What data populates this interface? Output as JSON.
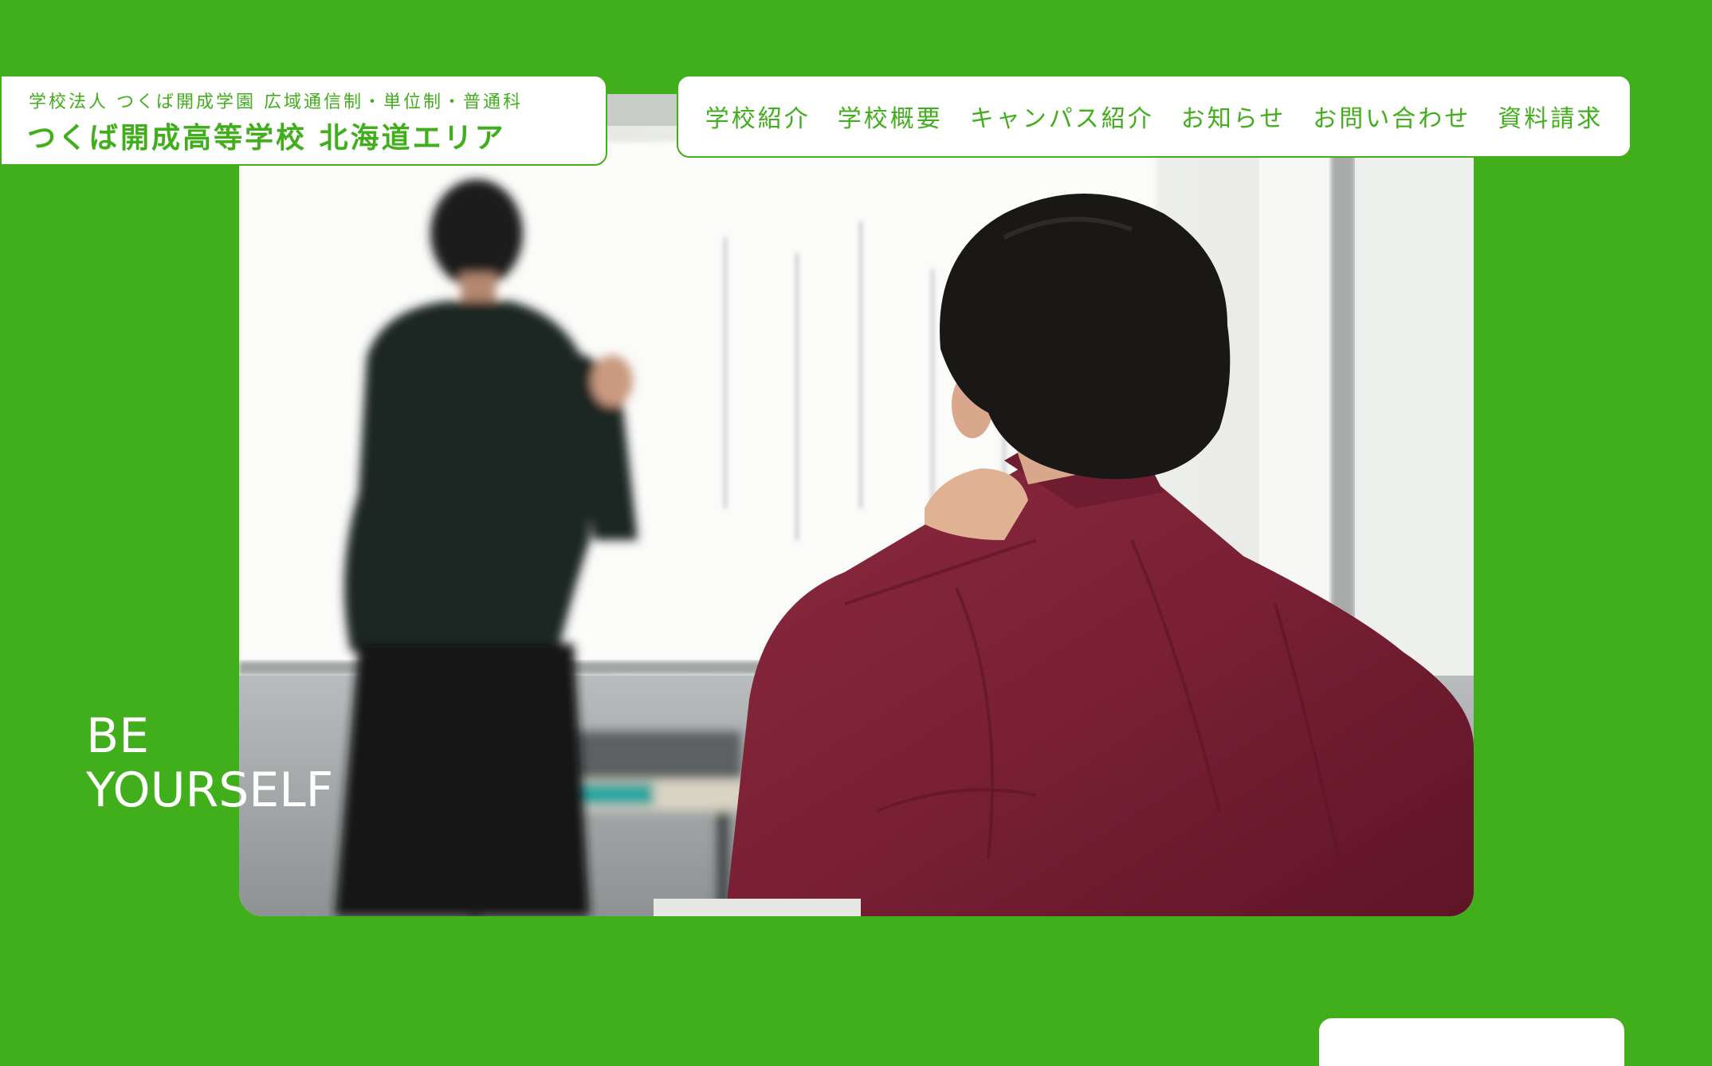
{
  "logo": {
    "subtitle": "学校法人 つくば開成学園 広域通信制・単位制・普通科",
    "title": "つくば開成高等学校 北海道エリア"
  },
  "nav": {
    "items": [
      {
        "label": "学校紹介"
      },
      {
        "label": "学校概要"
      },
      {
        "label": "キャンパス紹介"
      },
      {
        "label": "お知らせ"
      },
      {
        "label": "お問い合わせ"
      },
      {
        "label": "資料請求"
      }
    ]
  },
  "hero": {
    "tagline_line1": "BE",
    "tagline_line2": "YOURSELF"
  },
  "colors": {
    "brand_green": "#41ae1b",
    "white": "#ffffff"
  }
}
